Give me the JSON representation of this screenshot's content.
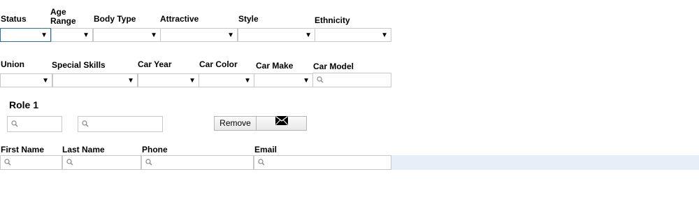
{
  "filters_row1": [
    {
      "label": "Status",
      "value": ""
    },
    {
      "label": "Age Range",
      "value": ""
    },
    {
      "label": "Body Type",
      "value": ""
    },
    {
      "label": "Attractive",
      "value": ""
    },
    {
      "label": "Style",
      "value": ""
    },
    {
      "label": "Ethnicity",
      "value": ""
    }
  ],
  "filters_row2": [
    {
      "label": "Union",
      "value": ""
    },
    {
      "label": "Special Skills",
      "value": ""
    },
    {
      "label": "Car Year",
      "value": ""
    },
    {
      "label": "Car Color",
      "value": ""
    },
    {
      "label": "Car Make",
      "value": ""
    },
    {
      "label": "Car Model",
      "value": ""
    }
  ],
  "role": {
    "title": "Role 1",
    "search1_value": "",
    "search2_value": "",
    "remove_label": "Remove",
    "email_icon": "envelope-icon"
  },
  "table": {
    "columns": [
      "First Name",
      "Last Name",
      "Phone",
      "Email"
    ],
    "filters": [
      "",
      "",
      "",
      ""
    ]
  },
  "colors": {
    "focus_border": "#2a6fb0",
    "row_highlight": "#e6eef8",
    "border": "#c8c8c8"
  },
  "icons": {
    "dropdown": "triangle-down-icon",
    "search": "magnifier-icon"
  }
}
